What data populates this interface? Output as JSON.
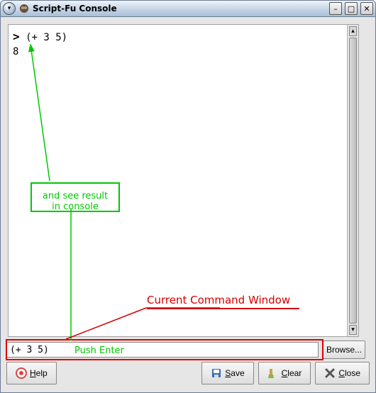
{
  "window": {
    "title": "Script-Fu Console",
    "app_icon": "gimp-wilber-icon"
  },
  "console": {
    "prompt_symbol": ">",
    "last_input": "(+ 3 5)",
    "last_output": "8"
  },
  "input": {
    "value": "(+ 3 5)",
    "browse_label": "Browse..."
  },
  "buttons": {
    "help": "Help",
    "save": "Save",
    "clear": "Clear",
    "close": "Close"
  },
  "annotations": {
    "result_box_line1": "and see result",
    "result_box_line2": "in console",
    "push_enter": "Push Enter",
    "command_window_label": "Current Command Window"
  },
  "colors": {
    "annotation_green": "#00c800",
    "annotation_red": "#d40000"
  }
}
